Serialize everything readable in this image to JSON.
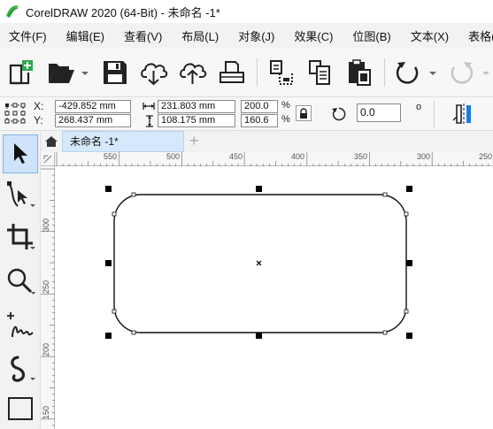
{
  "window": {
    "title": "CorelDRAW 2020 (64-Bit) - 未命名 -1*"
  },
  "menu": {
    "items": [
      {
        "label": "文件(F)"
      },
      {
        "label": "编辑(E)"
      },
      {
        "label": "查看(V)"
      },
      {
        "label": "布局(L)"
      },
      {
        "label": "对象(J)"
      },
      {
        "label": "效果(C)"
      },
      {
        "label": "位图(B)"
      },
      {
        "label": "文本(X)"
      },
      {
        "label": "表格(T)"
      }
    ]
  },
  "toolbar": {
    "icons": [
      "new-document-icon",
      "open-folder-icon",
      "save-icon",
      "cloud-download-icon",
      "cloud-upload-icon",
      "print-icon",
      "import-icon",
      "export-icon",
      "paste-icon",
      "undo-icon",
      "redo-icon"
    ]
  },
  "property_bar": {
    "x_label": "X:",
    "y_label": "Y:",
    "x_value": "-429.852 mm",
    "y_value": "268.437 mm",
    "width_value": "231.803 mm",
    "height_value": "108.175 mm",
    "scale_x": "200.0",
    "scale_y": "160.6",
    "percent": "%",
    "rotation_value": "0.0",
    "degree": "o"
  },
  "tabs": {
    "document": "未命名 -1*"
  },
  "rulers": {
    "horizontal_labels": [
      "550",
      "500",
      "450",
      "400",
      "350",
      "300",
      "250"
    ],
    "vertical_labels": [
      "300",
      "250",
      "200",
      "150"
    ]
  },
  "colors": {
    "accent": "#1f7ad8",
    "selected_tool": "#cfe4fb",
    "logo_green": "#3bb54a"
  }
}
